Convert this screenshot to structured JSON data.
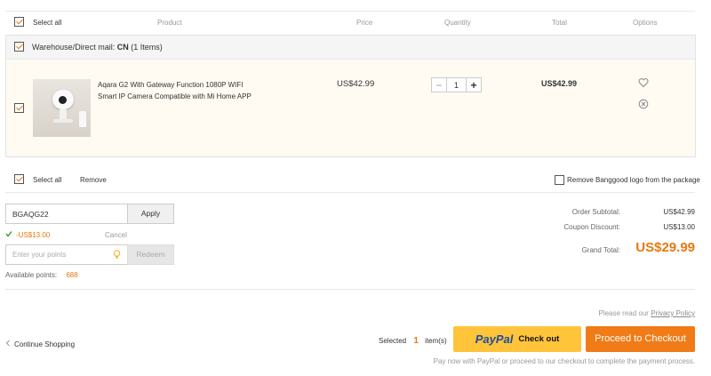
{
  "header": {
    "select_all": "Select all",
    "product": "Product",
    "price": "Price",
    "quantity": "Quantity",
    "total": "Total",
    "options": "Options"
  },
  "warehouse": {
    "label": "Warehouse/Direct mail:",
    "code": "CN",
    "count": "(1 Items)"
  },
  "item": {
    "name": "Aqara G2 With Gateway Function 1080P WIFI Smart IP Camera Compatible with Mi Home APP",
    "price": "US$42.99",
    "quantity": "1",
    "total": "US$42.99",
    "checked": true
  },
  "footer_bar": {
    "select_all": "Select all",
    "remove": "Remove",
    "remove_logo": "Remove Banggood logo from the package"
  },
  "coupon": {
    "value": "BGAQG22",
    "apply_label": "Apply",
    "discount": "-US$13.00",
    "cancel_label": "Cancel"
  },
  "points": {
    "placeholder": "Enter your points",
    "redeem_label": "Redeem",
    "available_label": "Available points:",
    "available_value": "688"
  },
  "summary": {
    "subtotal_label": "Order Subtotal:",
    "subtotal_value": "US$42.99",
    "coupon_label": "Coupon Discount:",
    "coupon_value": "US$13.00",
    "grand_label": "Grand Total:",
    "grand_value": "US$29.99"
  },
  "checkout": {
    "privacy_prefix": "Please read our",
    "privacy_link": "Privacy Policy",
    "continue": "Continue Shopping",
    "selected_prefix": "Selected",
    "selected_count": "1",
    "selected_suffix": "item(s)",
    "paypal_word": "PayPal",
    "paypal_checkout": "Check out",
    "proceed_label": "Proceed to Checkout",
    "note": "Pay now with PayPal or proceed to our checkout to complete the payment process."
  },
  "colors": {
    "accent": "#e8780d",
    "paypal_yellow": "#ffc439",
    "item_bg": "#fffaf2"
  }
}
